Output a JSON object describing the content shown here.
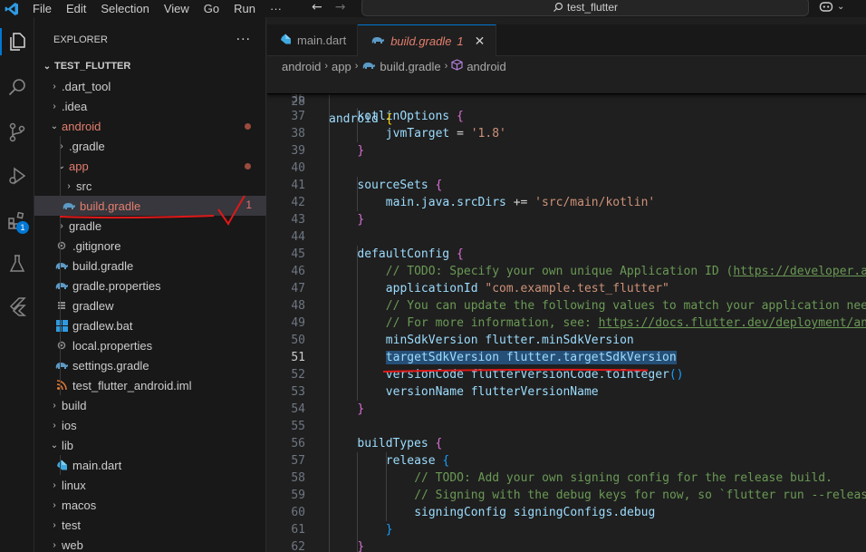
{
  "titlebar": {
    "menu": [
      "File",
      "Edit",
      "Selection",
      "View",
      "Go",
      "Run",
      "···"
    ],
    "search_label": "test_flutter"
  },
  "explorer": {
    "title": "EXPLORER",
    "more": "···",
    "section": "TEST_FLUTTER",
    "items": [
      {
        "label": ".dart_tool",
        "chevron": "›"
      },
      {
        "label": ".idea",
        "chevron": "›"
      },
      {
        "label": "android",
        "chevron": "⌄"
      },
      {
        "label": ".gradle",
        "chevron": "›"
      },
      {
        "label": "app",
        "chevron": "⌄"
      },
      {
        "label": "src",
        "chevron": "›"
      },
      {
        "label": "build.gradle",
        "count": "1"
      },
      {
        "label": "gradle",
        "chevron": "›"
      },
      {
        "label": ".gitignore"
      },
      {
        "label": "build.gradle"
      },
      {
        "label": "gradle.properties"
      },
      {
        "label": "gradlew"
      },
      {
        "label": "gradlew.bat"
      },
      {
        "label": "local.properties"
      },
      {
        "label": "settings.gradle"
      },
      {
        "label": "test_flutter_android.iml"
      },
      {
        "label": "build",
        "chevron": "›"
      },
      {
        "label": "ios",
        "chevron": "›"
      },
      {
        "label": "lib",
        "chevron": "⌄"
      },
      {
        "label": "main.dart"
      },
      {
        "label": "linux",
        "chevron": "›"
      },
      {
        "label": "macos",
        "chevron": "›"
      },
      {
        "label": "test",
        "chevron": "›"
      },
      {
        "label": "web",
        "chevron": "›"
      }
    ]
  },
  "activity": {
    "extensions_badge": "1"
  },
  "tabs": [
    {
      "label": "main.dart"
    },
    {
      "label": "build.gradle",
      "count": "1",
      "close": "✕"
    }
  ],
  "breadcrumb": [
    "android",
    "app",
    "build.gradle",
    "android"
  ],
  "editor": {
    "sticky": {
      "num": "28",
      "parts": [
        [
          "kw",
          "android "
        ],
        [
          "br",
          "{"
        ]
      ]
    },
    "lines": [
      {
        "num": "36",
        "parts": []
      },
      {
        "num": "37",
        "parts": [
          [
            "kw",
            "kotlinOptions "
          ],
          [
            "br2",
            "{"
          ]
        ]
      },
      {
        "num": "38",
        "parts": [
          [
            "kw",
            "jvmTarget "
          ],
          [
            "pl",
            "= "
          ],
          [
            "str",
            "'1.8'"
          ]
        ]
      },
      {
        "num": "39",
        "parts": [
          [
            "br2",
            "}"
          ]
        ]
      },
      {
        "num": "40",
        "parts": []
      },
      {
        "num": "41",
        "parts": [
          [
            "kw",
            "sourceSets "
          ],
          [
            "br2",
            "{"
          ]
        ]
      },
      {
        "num": "42",
        "parts": [
          [
            "kw",
            "main.java.srcDirs "
          ],
          [
            "pl",
            "+= "
          ],
          [
            "str",
            "'src/main/kotlin'"
          ]
        ]
      },
      {
        "num": "43",
        "parts": [
          [
            "br2",
            "}"
          ]
        ]
      },
      {
        "num": "44",
        "parts": []
      },
      {
        "num": "45",
        "parts": [
          [
            "kw",
            "defaultConfig "
          ],
          [
            "br2",
            "{"
          ]
        ]
      },
      {
        "num": "46",
        "parts": [
          [
            "cmt",
            "// TODO: Specify your own unique Application ID ("
          ],
          [
            "url",
            "https://developer.an"
          ]
        ]
      },
      {
        "num": "47",
        "parts": [
          [
            "kw",
            "applicationId "
          ],
          [
            "str",
            "\"com.example.test_flutter\""
          ]
        ]
      },
      {
        "num": "48",
        "parts": [
          [
            "cmt",
            "// You can update the following values to match your application need"
          ]
        ]
      },
      {
        "num": "49",
        "parts": [
          [
            "cmt",
            "// For more information, see: "
          ],
          [
            "url",
            "https://docs.flutter.dev/deployment/and"
          ]
        ]
      },
      {
        "num": "50",
        "parts": [
          [
            "kw",
            "minSdkVersion flutter.minSdkVersion"
          ]
        ]
      },
      {
        "num": "51",
        "parts": [
          [
            "kw",
            "targetSdkVersion flutter.targetSdkVersion"
          ]
        ]
      },
      {
        "num": "52",
        "parts": [
          [
            "kw",
            "versionCode flutterVersionCode.toInteger"
          ],
          [
            "br3",
            "()"
          ]
        ]
      },
      {
        "num": "53",
        "parts": [
          [
            "kw",
            "versionName flutterVersionName"
          ]
        ]
      },
      {
        "num": "54",
        "parts": [
          [
            "br2",
            "}"
          ]
        ]
      },
      {
        "num": "55",
        "parts": []
      },
      {
        "num": "56",
        "parts": [
          [
            "kw",
            "buildTypes "
          ],
          [
            "br2",
            "{"
          ]
        ]
      },
      {
        "num": "57",
        "parts": [
          [
            "kw",
            "release "
          ],
          [
            "br3",
            "{"
          ]
        ]
      },
      {
        "num": "58",
        "parts": [
          [
            "cmt",
            "// TODO: Add your own signing config for the release build."
          ]
        ]
      },
      {
        "num": "59",
        "parts": [
          [
            "cmt",
            "// Signing with the debug keys for now, so `flutter run --release"
          ]
        ]
      },
      {
        "num": "60",
        "parts": [
          [
            "kw",
            "signingConfig signingConfigs.debug"
          ]
        ]
      },
      {
        "num": "61",
        "parts": [
          [
            "br3",
            "}"
          ]
        ]
      },
      {
        "num": "62",
        "parts": [
          [
            "br2",
            "}"
          ]
        ]
      }
    ]
  }
}
